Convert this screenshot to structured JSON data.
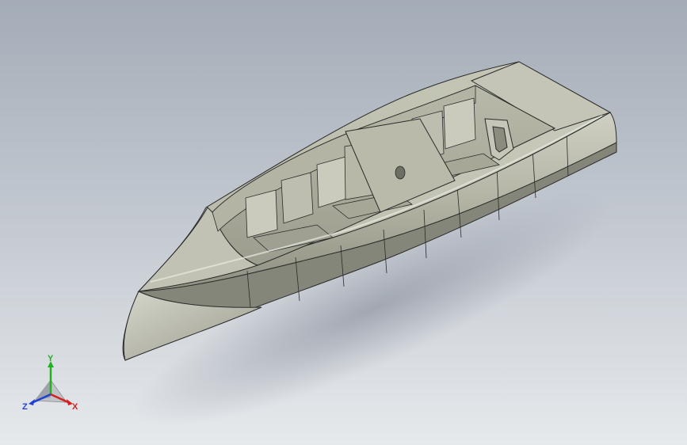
{
  "triad": {
    "x_label": "X",
    "y_label": "Y",
    "z_label": "Z",
    "x_color": "#d42020",
    "y_color": "#20b020",
    "z_color": "#2040d0"
  },
  "model": {
    "hull_color": "#b7b8a8",
    "interior_color": "#a9aa98",
    "edge_color": "#2a2a2a"
  }
}
